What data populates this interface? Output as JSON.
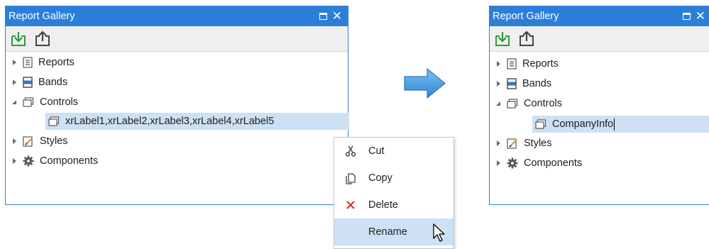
{
  "left_panel": {
    "title": "Report Gallery",
    "toolbar": {
      "import_icon": "import-icon",
      "export_icon": "export-icon"
    },
    "tree": {
      "reports": "Reports",
      "bands": "Bands",
      "controls": "Controls",
      "selected_item": "xrLabel1,xrLabel2,xrLabel3,xrLabel4,xrLabel5",
      "styles": "Styles",
      "components": "Components"
    }
  },
  "context_menu": {
    "items": [
      {
        "label": "Cut",
        "icon": "scissors-icon"
      },
      {
        "label": "Copy",
        "icon": "copy-icon"
      },
      {
        "label": "Delete",
        "icon": "delete-x-icon"
      },
      {
        "label": "Rename",
        "icon": "",
        "highlighted": true
      }
    ]
  },
  "right_panel": {
    "title": "Report Gallery",
    "tree": {
      "reports": "Reports",
      "bands": "Bands",
      "controls": "Controls",
      "renamed_item": "CompanyInfo",
      "styles": "Styles",
      "components": "Components"
    }
  },
  "colors": {
    "titlebar": "#2b7fd9",
    "selection": "#cde0f4",
    "arrow": "#3d97e0",
    "import_green": "#2e9b3c",
    "delete_red": "#d9332e"
  }
}
